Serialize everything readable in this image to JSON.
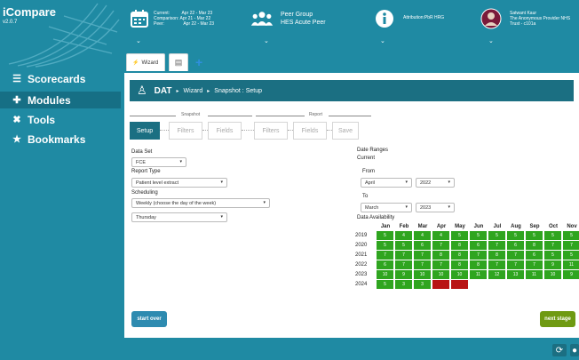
{
  "app": {
    "name": "iCompare",
    "version": "v2.0.7"
  },
  "nav": [
    {
      "label": "Scorecards",
      "icon": "list-icon"
    },
    {
      "label": "Modules",
      "icon": "puzzle-icon",
      "active": true
    },
    {
      "label": "Tools",
      "icon": "tools-icon"
    },
    {
      "label": "Bookmarks",
      "icon": "star-icon"
    }
  ],
  "topbar": {
    "dates": {
      "current_label": "Current:",
      "current": "Apr 22 - Mar 23",
      "comparison_label": "Comparison:",
      "comparison": "Apr 21 - Mar 22",
      "peer_label": "Peer:",
      "peer": "Apr 22 - Mar 23"
    },
    "peer_group": {
      "title": "Peer Group",
      "value": "HES Acute Peer"
    },
    "attribution": {
      "label": "Attribution:PbR HRG"
    },
    "user": {
      "name": "Satwant Kaur",
      "org": "The Anonymous Provider NHS",
      "trust": "Trust - c101a"
    }
  },
  "tabs": {
    "wizard_label": "Wizard"
  },
  "breadcrumb": {
    "root": "DAT",
    "wizard": "Wizard",
    "current": "Snapshot : Setup"
  },
  "groups": {
    "snapshot": "Snapshot",
    "report": "Report"
  },
  "steps": [
    "Setup",
    "Filters",
    "Fields",
    "Filters",
    "Fields",
    "Save"
  ],
  "form": {
    "data_set_label": "Data Set",
    "data_set_value": "FCE",
    "report_type_label": "Report Type",
    "report_type_value": "Patient level extract",
    "scheduling_label": "Scheduling",
    "scheduling_value": "Weekly (choose the day of the week)",
    "day_value": "Thursday"
  },
  "date_ranges": {
    "title": "Date Ranges",
    "current_label": "Current",
    "from_label": "From",
    "from_month": "April",
    "from_year": "2022",
    "to_label": "To",
    "to_month": "March",
    "to_year": "2023",
    "availability_label": "Data Availability"
  },
  "availability": {
    "months": [
      "Jan",
      "Feb",
      "Mar",
      "Apr",
      "May",
      "Jun",
      "Jul",
      "Aug",
      "Sep",
      "Oct",
      "Nov",
      "Dec"
    ],
    "colors": {
      "available": "#2fa51f",
      "missing": "#b81414"
    },
    "rows": [
      {
        "year": "2019",
        "values": [
          "5",
          "4",
          "4",
          "4",
          "5",
          "5",
          "5",
          "5",
          "5",
          "5",
          "5",
          "5"
        ]
      },
      {
        "year": "2020",
        "values": [
          "5",
          "5",
          "6",
          "7",
          "8",
          "6",
          "7",
          "6",
          "8",
          "7",
          "7",
          "7"
        ]
      },
      {
        "year": "2021",
        "values": [
          "7",
          "7",
          "7",
          "8",
          "8",
          "7",
          "8",
          "7",
          "6",
          "5",
          "5",
          "6"
        ]
      },
      {
        "year": "2022",
        "values": [
          "6",
          "7",
          "7",
          "7",
          "8",
          "8",
          "7",
          "7",
          "7",
          "9",
          "11",
          "11"
        ]
      },
      {
        "year": "2023",
        "values": [
          "10",
          "9",
          "10",
          "10",
          "10",
          "11",
          "12",
          "13",
          "11",
          "10",
          "9",
          "7"
        ]
      },
      {
        "year": "2024",
        "values": [
          "5",
          "3",
          "3",
          "",
          "",
          null,
          null,
          null,
          null,
          null,
          null,
          null
        ],
        "missing": [
          3,
          4
        ]
      }
    ]
  },
  "buttons": {
    "start_over": "start over",
    "next_stage": "next stage"
  },
  "accent": "#1f8aa3"
}
